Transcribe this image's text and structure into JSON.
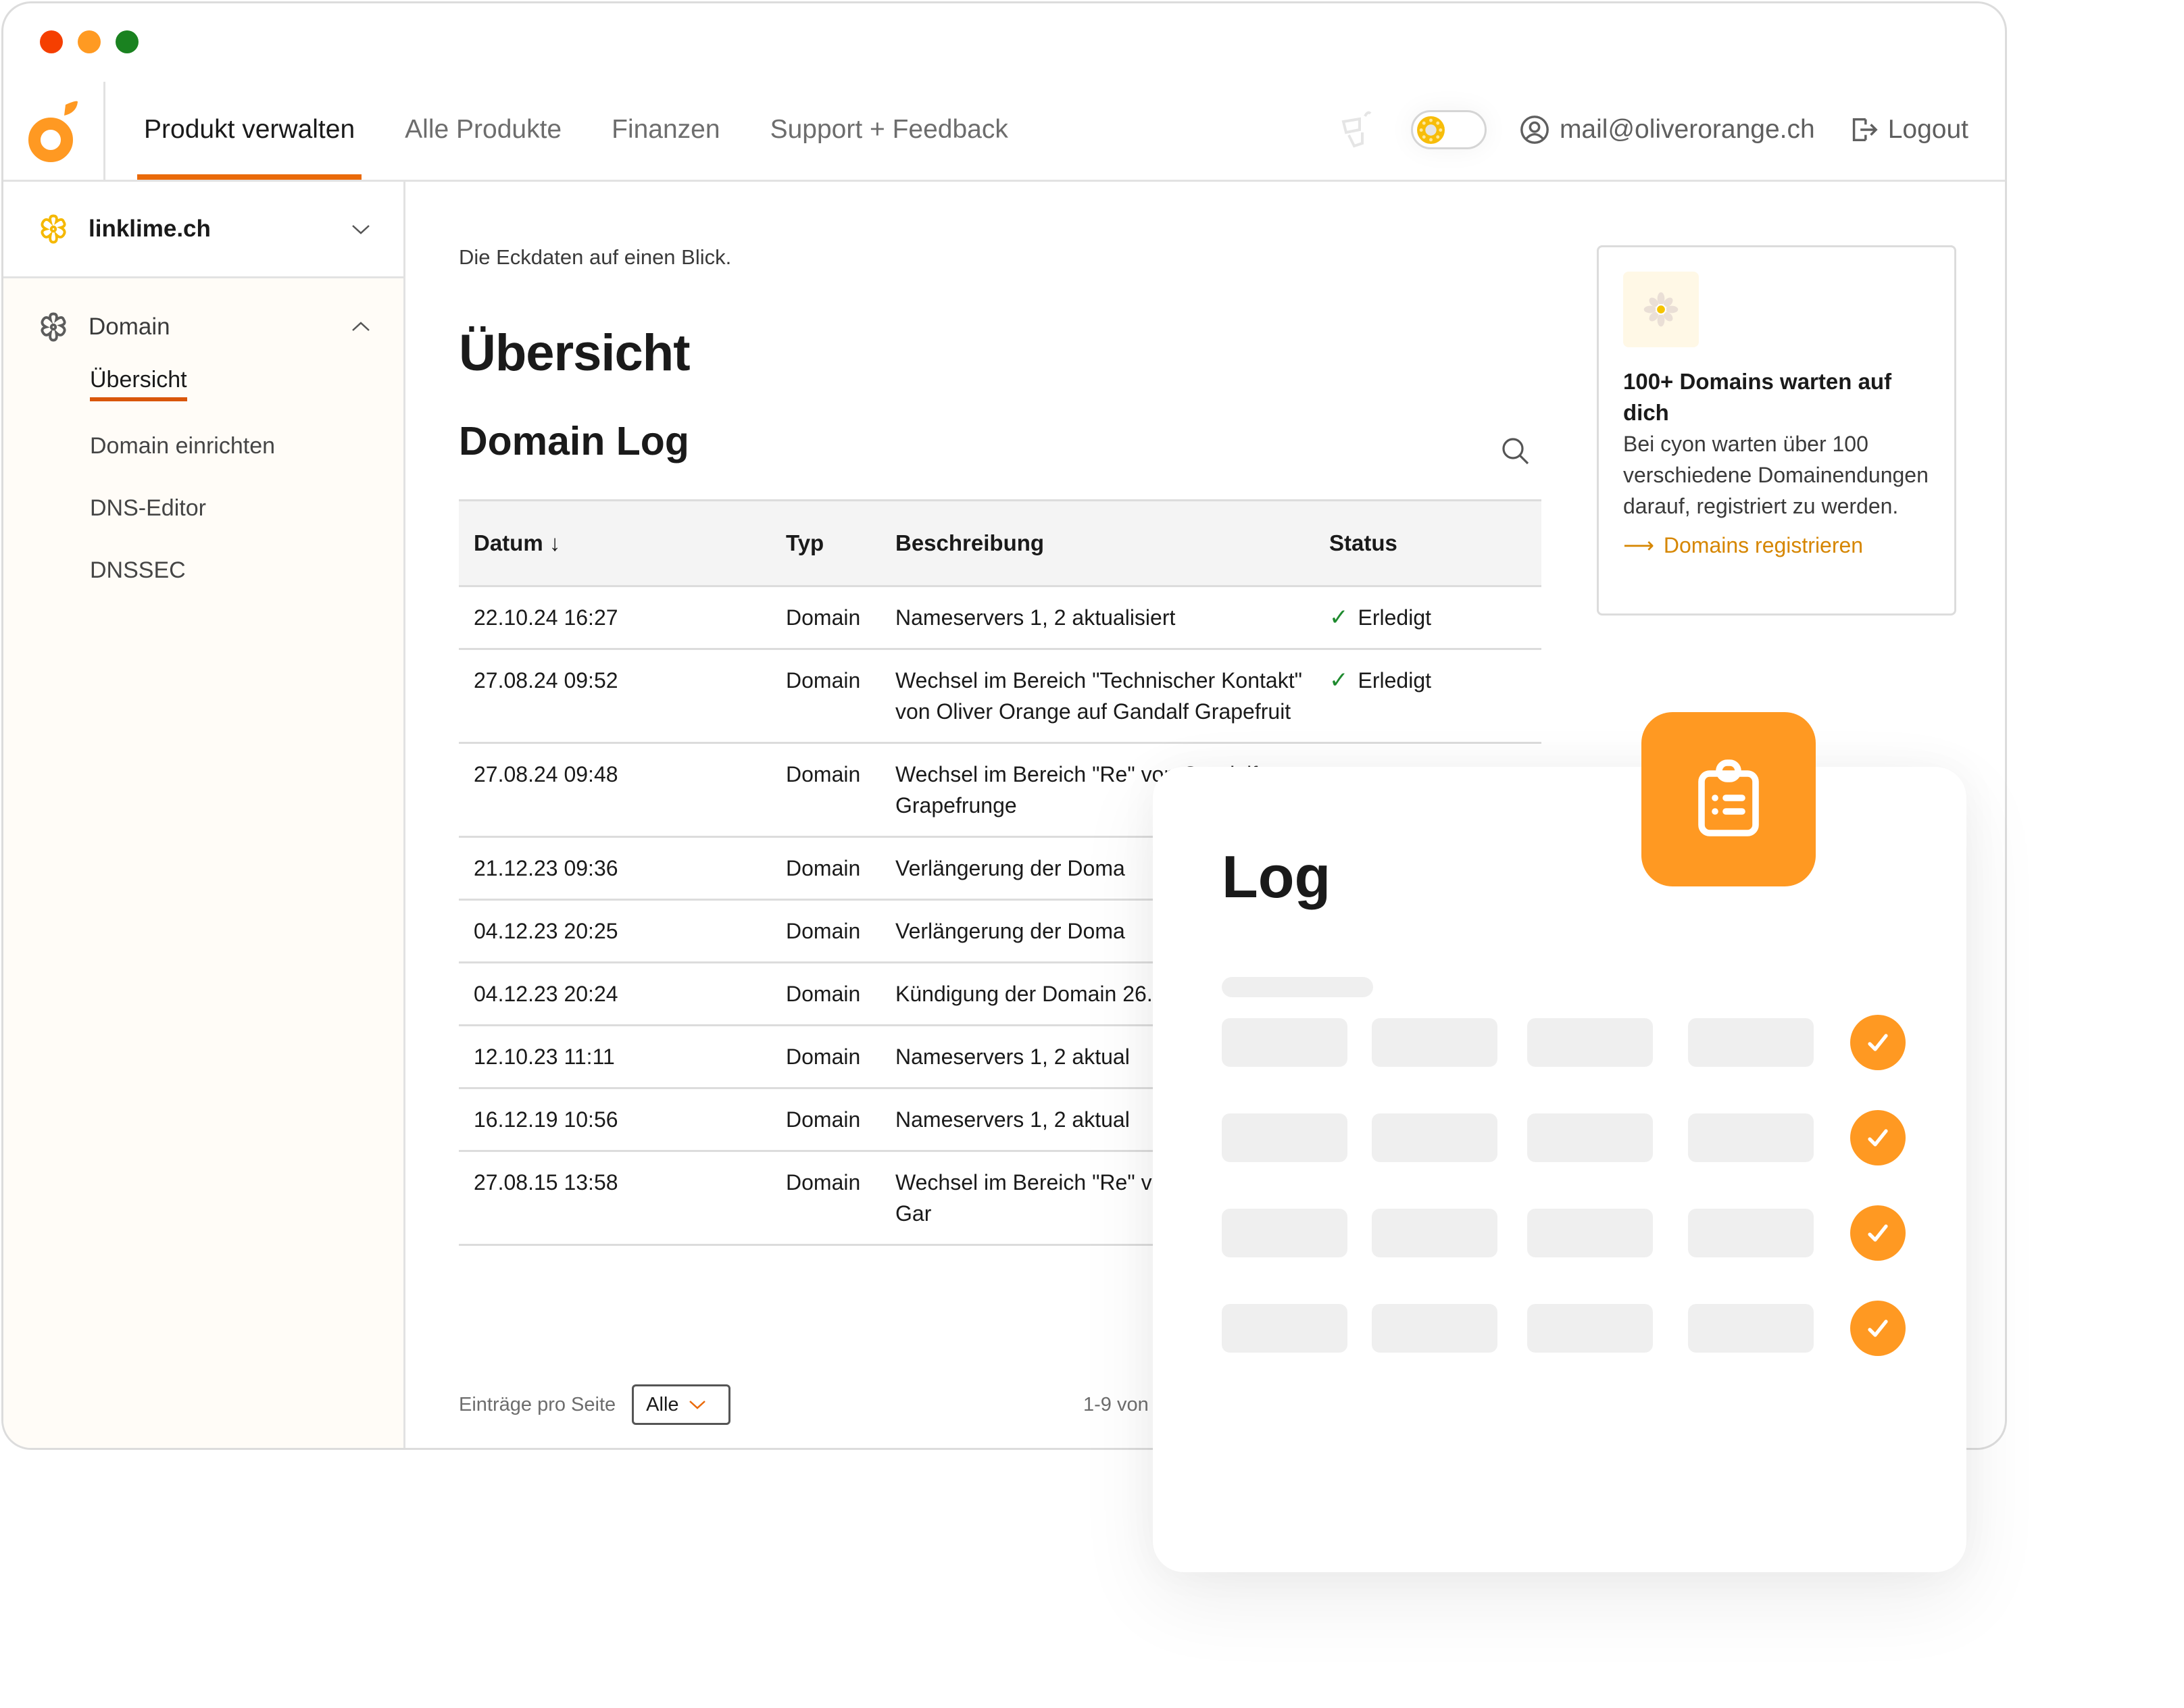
{
  "window": {
    "traffic_lights": [
      "close",
      "minimize",
      "maximize"
    ]
  },
  "header": {
    "logo": "cyon-orange-logo",
    "nav": [
      {
        "label": "Produkt verwalten",
        "active": true
      },
      {
        "label": "Alle Produkte",
        "active": false
      },
      {
        "label": "Finanzen",
        "active": false
      },
      {
        "label": "Support + Feedback",
        "active": false
      }
    ],
    "theme_toggle": {
      "state": "light",
      "icon": "sun-icon"
    },
    "user_email": "mail@oliverorange.ch",
    "logout_label": "Logout"
  },
  "sidebar": {
    "product": {
      "name": "linklime.ch",
      "icon": "flower-icon"
    },
    "group": {
      "label": "Domain",
      "expanded": true,
      "icon": "flower-outline-icon"
    },
    "items": [
      {
        "label": "Übersicht",
        "active": true
      },
      {
        "label": "Domain einrichten",
        "active": false
      },
      {
        "label": "DNS-Editor",
        "active": false
      },
      {
        "label": "DNSSEC",
        "active": false
      }
    ]
  },
  "main": {
    "lead": "Die Eckdaten auf einen Blick.",
    "title": "Übersicht",
    "section_title": "Domain Log",
    "table": {
      "columns": [
        "Datum",
        "Typ",
        "Beschreibung",
        "Status"
      ],
      "sort_indicator": "↓",
      "rows": [
        {
          "date": "22.10.24 16:27",
          "type": "Domain",
          "desc": "Nameservers 1, 2 aktualisiert",
          "status": "Erledigt"
        },
        {
          "date": "27.08.24 09:52",
          "type": "Domain",
          "desc": "Wechsel im Bereich \"Technischer Kontakt\" von Oliver Orange auf Gandalf Grapefruit",
          "status": "Erledigt"
        },
        {
          "date": "27.08.24 09:48",
          "type": "Domain",
          "desc": "Wechsel im Bereich \"Re\" von Gandalf Grapefrunge",
          "status": ""
        },
        {
          "date": "21.12.23 09:36",
          "type": "Domain",
          "desc": "Verlängerung der Doma",
          "status": ""
        },
        {
          "date": "04.12.23 20:25",
          "type": "Domain",
          "desc": "Verlängerung der Doma",
          "status": ""
        },
        {
          "date": "04.12.23 20:24",
          "type": "Domain",
          "desc": "Kündigung der Domain 26.08.2024",
          "status": ""
        },
        {
          "date": "12.10.23 11:11",
          "type": "Domain",
          "desc": "Nameservers 1, 2 aktual",
          "status": ""
        },
        {
          "date": "16.12.19 10:56",
          "type": "Domain",
          "desc": "Nameservers 1, 2 aktual",
          "status": ""
        },
        {
          "date": "27.08.15 13:58",
          "type": "Domain",
          "desc": "Wechsel im Bereich \"Re\" von Link Lime auf Gar",
          "status": ""
        }
      ]
    },
    "footer": {
      "per_page_label": "Einträge pro Seite",
      "per_page_value": "Alle",
      "pagination": "1-9 von"
    }
  },
  "promo": {
    "title": "100+ Domains warten auf dich",
    "text": "Bei cyon warten über 100 verschiedene Domainendungen darauf, registriert zu werden.",
    "link": "Domains registrieren",
    "colors": {
      "link": "#d68600"
    }
  },
  "overlay": {
    "title": "Log",
    "badge_icon": "clipboard-list-icon",
    "skeleton_rows": 4,
    "row_status": "done",
    "colors": {
      "accent": "#ff9922"
    }
  },
  "colors": {
    "brand_orange": "#ff9922",
    "nav_underline": "#ea6a0a",
    "success_green": "#1e8a2e"
  }
}
